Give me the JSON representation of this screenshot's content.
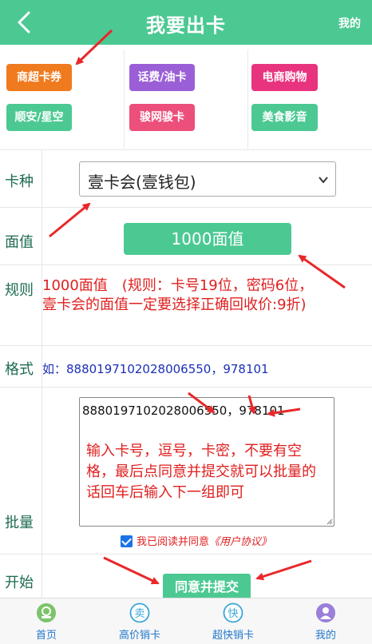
{
  "header": {
    "title": "我要出卡",
    "right_link": "我的"
  },
  "categories": [
    {
      "label": "商超卡券",
      "color": "#f07a1e"
    },
    {
      "label": "话费/油卡",
      "color": "#9a5fd6"
    },
    {
      "label": "电商购物",
      "color": "#e8347f"
    },
    {
      "label": "顺安/星空",
      "color": "#4cc993"
    },
    {
      "label": "骏网骏卡",
      "color": "#ec4f7a"
    },
    {
      "label": "美食影音",
      "color": "#4cc993"
    }
  ],
  "form": {
    "card_type_label": "卡种",
    "card_type_value": "壹卡会(壹钱包)",
    "face_value_label": "面值",
    "face_value_button": "1000面值",
    "rule_label": "规则",
    "rule_text": "1000面值　(规则：卡号19位，密码6位，壹卡会的面值一定要选择正确回收价:9折)",
    "format_label": "格式",
    "format_text": "如：8880197102028006550，978101",
    "batch_label": "批量",
    "batch_value": "8880197102028006550，978101",
    "batch_hint": "输入卡号，逗号，卡密，不要有空格，最后点同意并提交就可以批量的话回车后输入下一组即可",
    "agree_text": "我已阅读并同意",
    "agree_link": "《用户协议》",
    "start_label": "开始",
    "submit_button": "同意并提交"
  },
  "bottom_nav": [
    {
      "label": "首页",
      "icon": "home-icon",
      "color": "#7cc36b"
    },
    {
      "label": "高价销卡",
      "icon": "sell-icon",
      "color": "#3aa7d8"
    },
    {
      "label": "超快销卡",
      "icon": "fast-icon",
      "color": "#3aa7d8"
    },
    {
      "label": "我的",
      "icon": "user-icon",
      "color": "#9b7fd8"
    }
  ],
  "colors": {
    "primary": "#4cc993",
    "warning_text": "#e02020",
    "format_text": "#1c2fb8"
  }
}
